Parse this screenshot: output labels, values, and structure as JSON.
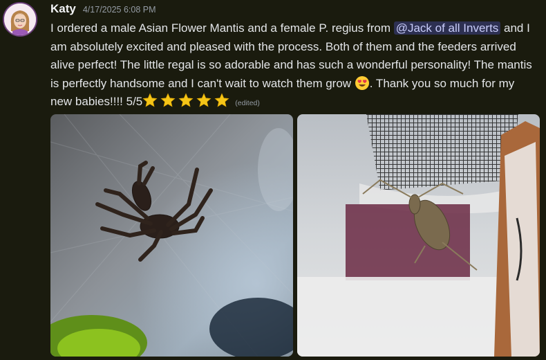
{
  "author": {
    "name": "Katy",
    "timestamp": "4/17/2025 6:08 PM"
  },
  "message": {
    "text_part1": "I ordered a male Asian Flower Mantis and a female P. regius from ",
    "mention": "@Jack of all Inverts",
    "text_part2": "  and I am absolutely excited and pleased with the process. Both of them and the feeders arrived alive perfect! The little regal is so adorable and has such a wonderful personality! The mantis is perfectly handsome and I can't wait to watch them grow ",
    "text_part3": ". Thank you so much for my new babies!!!!  5/5",
    "edited_label": "(edited)",
    "emoji_1": "heart-eyes-emoji",
    "star_count": 5
  },
  "attachments": [
    {
      "subject": "jumping-spider-photo"
    },
    {
      "subject": "mantis-photo"
    }
  ],
  "colors": {
    "background": "#1a1b0e",
    "mention_bg": "#3a3f6e",
    "star": "#f5c518"
  }
}
